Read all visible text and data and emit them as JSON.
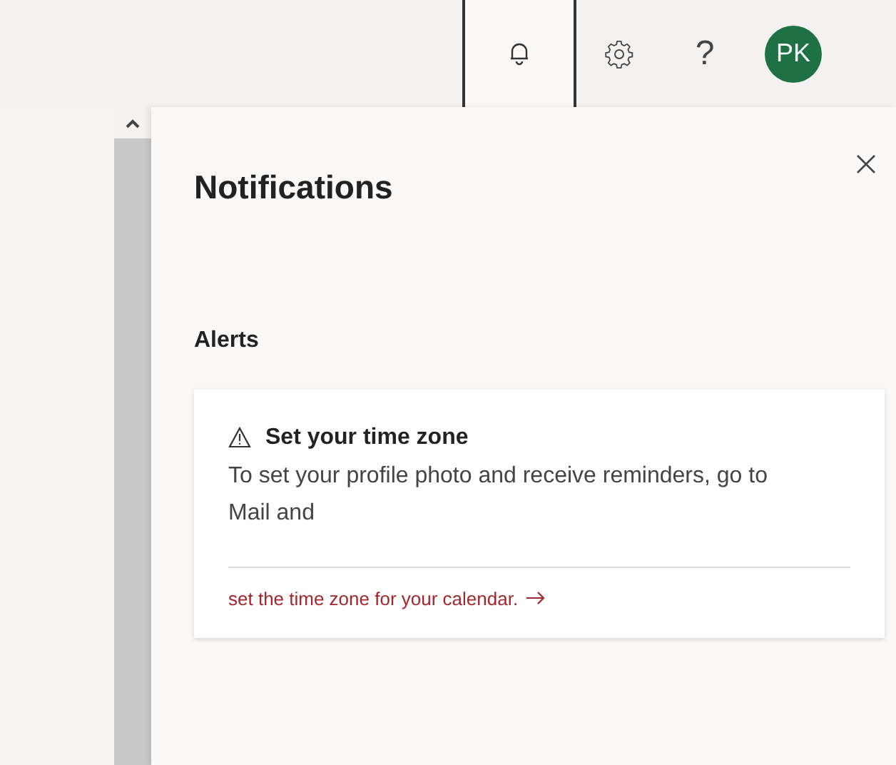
{
  "header_buttons": [
    {
      "kind": "bell",
      "selected": true
    },
    {
      "kind": "gear",
      "selected": false
    },
    {
      "kind": "help",
      "label": "?",
      "selected": false
    }
  ],
  "avatar": {
    "initials": "PK",
    "color": "#1e7145"
  },
  "panel": {
    "title": "Notifications",
    "section": "Alerts",
    "alerts": [
      {
        "title": "Set your time zone",
        "body": "To set your profile photo and receive reminders, go to Mail and",
        "link": "set the time zone for your calendar."
      }
    ]
  }
}
